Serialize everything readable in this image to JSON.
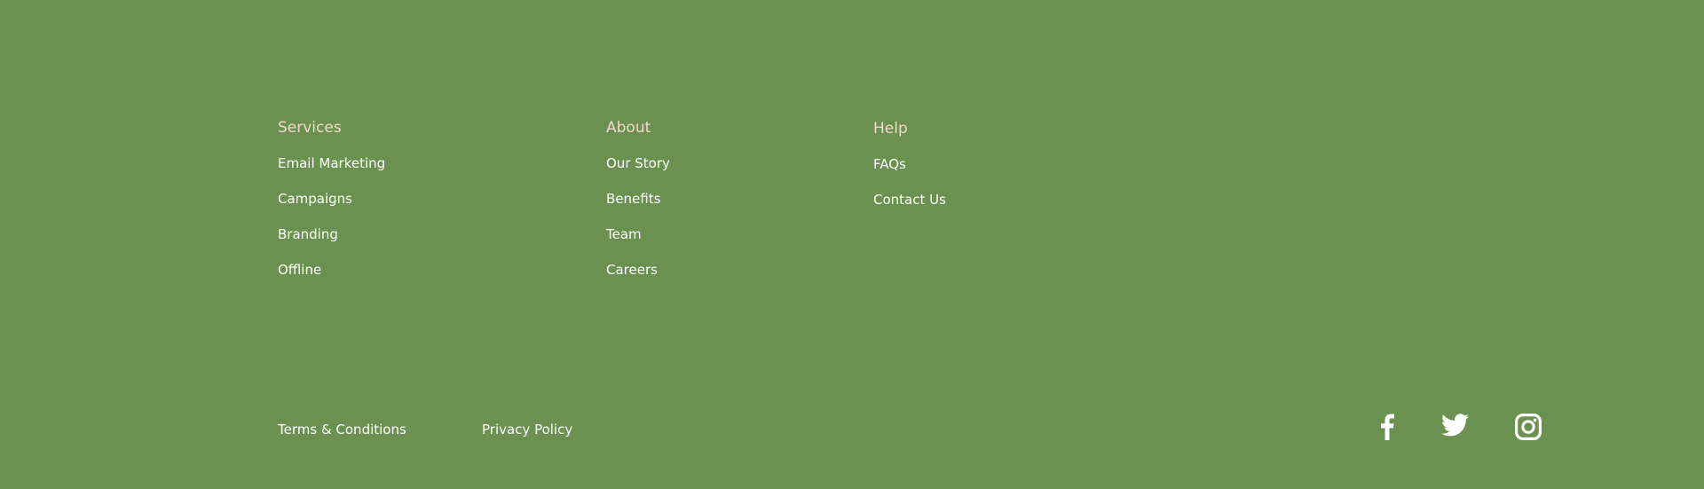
{
  "footer": {
    "columns": [
      {
        "heading": "Services",
        "links": [
          "Email Marketing",
          "Campaigns",
          "Branding",
          "Offline"
        ]
      },
      {
        "heading": "About",
        "links": [
          "Our Story",
          "Benefits",
          "Team",
          "Careers"
        ]
      },
      {
        "heading": "Help",
        "links": [
          "FAQs",
          "Contact Us"
        ]
      }
    ],
    "legal": {
      "terms": "Terms & Conditions",
      "privacy": "Privacy Policy"
    },
    "social": [
      {
        "icon": "facebook-icon"
      },
      {
        "icon": "twitter-icon"
      },
      {
        "icon": "instagram-icon"
      }
    ],
    "colors": {
      "background": "#6a914f",
      "heading": "#f3d8cd",
      "link": "#ffffff"
    }
  }
}
